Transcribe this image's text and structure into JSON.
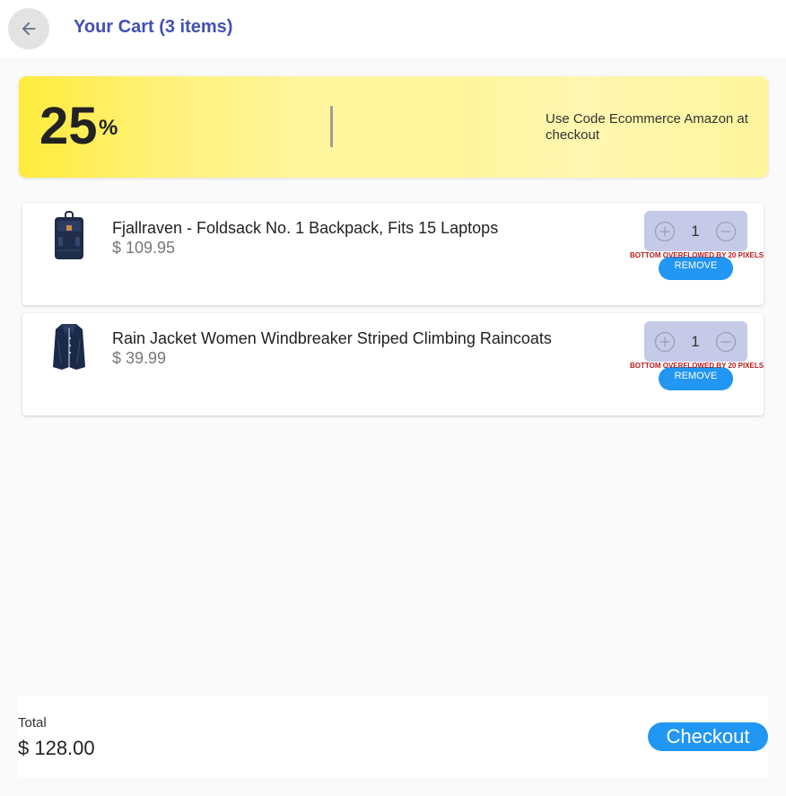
{
  "header": {
    "title": "Your Cart (3 items)",
    "back_icon": "arrow-back-icon"
  },
  "promo": {
    "discount": "25",
    "unit": "%",
    "text": "Use Code Ecommerce Amazon at checkout"
  },
  "items": [
    {
      "name": "Fjallraven - Foldsack No. 1 Backpack, Fits 15 Laptops",
      "price": "$ 109.95",
      "quantity": "1",
      "overflow_warning": "BOTTOM OVERFLOWED BY 20 PIXELS",
      "remove_label": "REMOVE",
      "image_icon": "backpack-image"
    },
    {
      "name": "Rain Jacket Women Windbreaker Striped Climbing Raincoats",
      "price": "$ 39.99",
      "quantity": "1",
      "overflow_warning": "BOTTOM OVERFLOWED BY 20 PIXELS",
      "remove_label": "REMOVE",
      "image_icon": "jacket-image"
    }
  ],
  "footer": {
    "total_label": "Total",
    "total_value": "$ 128.00",
    "checkout_label": "Checkout"
  },
  "colors": {
    "accent": "#2196f3",
    "title": "#3f51b5",
    "qty_bg": "#c5cae9",
    "promo": "#fff59d",
    "warning": "#b71c1c"
  }
}
